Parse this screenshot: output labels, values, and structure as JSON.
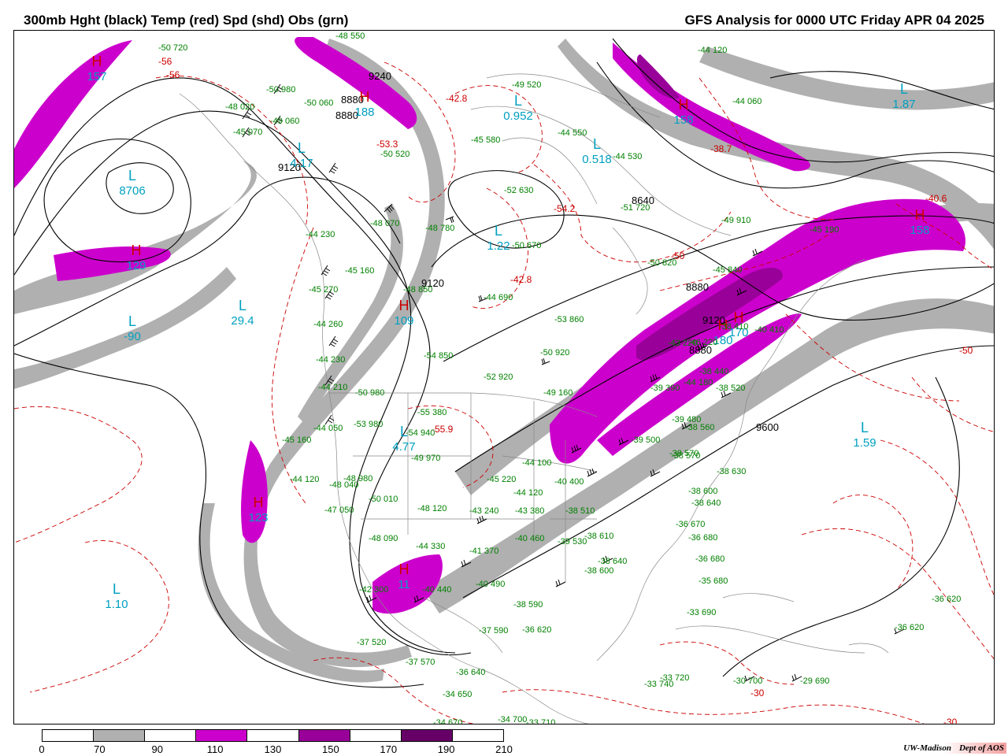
{
  "header": {
    "left_title": "300mb Hght (black) Temp (red) Spd (shd) Obs (grn)",
    "right_title": "GFS Analysis for 0000 UTC Friday  APR 04 2025"
  },
  "colorbar": {
    "fills": [
      "#ffffff",
      "#b0b0b0",
      "#ffffff",
      "#cc00cc",
      "#ffffff",
      "#990099",
      "#ffffff",
      "#660066",
      "#ffffff"
    ],
    "labels": [
      "0",
      "70",
      "90",
      "110",
      "130",
      "150",
      "170",
      "190",
      "210"
    ]
  },
  "colors": {
    "height_contour": "#000000",
    "temperature_contour": "#cc0000",
    "speed_70": "#b0b0b0",
    "speed_110": "#cc00cc",
    "speed_150": "#990099",
    "observation_text": "#008000",
    "center_label": "#00a0c0"
  },
  "height_labels": [
    "9240",
    "8880",
    "8880",
    "9120",
    "9120",
    "8880",
    "8640",
    "8880",
    "9120",
    "9600"
  ],
  "temperature_labels": [
    "-56",
    "-56",
    "-42.8",
    "-53.3",
    "-38.7",
    "-54.2",
    "-40.6",
    "-42.8",
    "-55.9",
    "-50",
    "-50",
    "-30",
    "-30"
  ],
  "pressure_centers": [
    {
      "type": "H",
      "value": "157"
    },
    {
      "type": "L",
      "value": "8706"
    },
    {
      "type": "H",
      "value": "129"
    },
    {
      "type": "L",
      "value": "-90"
    },
    {
      "type": "L",
      "value": "29.4"
    },
    {
      "type": "L",
      "value": "4.17"
    },
    {
      "type": "H",
      "value": "188"
    },
    {
      "type": "L",
      "value": "0.952"
    },
    {
      "type": "L",
      "value": "0.518"
    },
    {
      "type": "H",
      "value": "158"
    },
    {
      "type": "L",
      "value": "1.87"
    },
    {
      "type": "H",
      "value": "158"
    },
    {
      "type": "L",
      "value": "1.22"
    },
    {
      "type": "H",
      "value": "109"
    },
    {
      "type": "L",
      "value": "4.77"
    },
    {
      "type": "H",
      "value": "123"
    },
    {
      "type": "H",
      "value": "11"
    },
    {
      "type": "L",
      "value": "1.10"
    },
    {
      "type": "L",
      "value": "1.59"
    },
    {
      "type": "H",
      "value": "180"
    },
    {
      "type": "H",
      "value": "170"
    }
  ],
  "observations": [
    "-48 550",
    "-50 720",
    "-50 980",
    "-50 060",
    "-48 020",
    "-49 060",
    "-45 070",
    "-49 520",
    "-45 580",
    "-44 550",
    "-44 530",
    "-44 120",
    "-44 060",
    "-50 520",
    "-52 630",
    "-51 720",
    "-49 910",
    "-45 190",
    "-44 230",
    "-48 070",
    "-48 780",
    "-50 670",
    "-45 160",
    "-45 270",
    "-44 690",
    "-53 860",
    "-50 820",
    "-45 840",
    "-44 260",
    "-48 850",
    "-54 850",
    "-50 920",
    "-44 230",
    "-52 920",
    "-49 160",
    "-44 210",
    "-50 980",
    "-53 980",
    "-55 380",
    "-54 940",
    "-44 050",
    "-45 160",
    "-49 970",
    "-44 120",
    "-48 040",
    "-48 980",
    "-47 050",
    "-50 010",
    "-45 220",
    "-44 100",
    "-40 400",
    "-44 120",
    "-48 120",
    "-43 240",
    "-43 380",
    "-38 510",
    "-48 090",
    "-44 330",
    "-41 370",
    "-40 460",
    "-39 530",
    "-38 610",
    "-38 600",
    "-38 640",
    "-42 300",
    "-40 440",
    "-40 490",
    "-38 590",
    "-37 590",
    "-36 620",
    "-37 520",
    "-37 570",
    "-36 640",
    "-34 650",
    "-34 670",
    "-34 700",
    "-33 710",
    "-33 740",
    "-33 720",
    "-30 700",
    "-29 690",
    "-36 620",
    "-36 620",
    "-38 570",
    "-38 630",
    "-38 640",
    "-36 670",
    "-36 680",
    "-36 680",
    "-35 680",
    "-33 690",
    "-39 500",
    "-38 570",
    "-38 560",
    "-38 600",
    "-39 480",
    "-38 440",
    "-38 520",
    "-39 390",
    "-38 410",
    "-40 410",
    "-43 220",
    "-46 220",
    "-44 180"
  ],
  "footer": {
    "credit_org": "UW-Madison",
    "credit_dept": "Dept of AOS"
  }
}
